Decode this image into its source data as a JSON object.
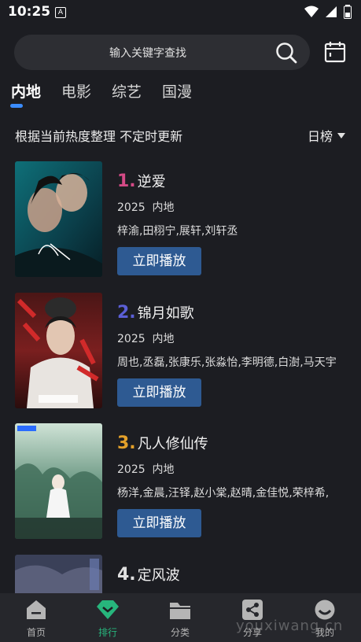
{
  "status_bar": {
    "time": "10:25",
    "badge": "A"
  },
  "search": {
    "placeholder": "输入关键字查找"
  },
  "tabs": [
    {
      "label": "内地",
      "active": true
    },
    {
      "label": "电影",
      "active": false
    },
    {
      "label": "综艺",
      "active": false
    },
    {
      "label": "国漫",
      "active": false
    }
  ],
  "subtitle": "根据当前热度整理 不定时更新",
  "rank_select": {
    "selected": "日榜"
  },
  "list": [
    {
      "rank": "1.",
      "rank_color": "#d44a86",
      "title": "逆爱",
      "year": "2025",
      "region": "内地",
      "cast": "梓渝,田栩宁,展轩,刘轩丞",
      "button": "立即播放"
    },
    {
      "rank": "2.",
      "rank_color": "#5b5fd6",
      "title": "锦月如歌",
      "year": "2025",
      "region": "内地",
      "cast": "周也,丞磊,张康乐,张淼怡,李明德,白澍,马天宇",
      "button": "立即播放"
    },
    {
      "rank": "3.",
      "rank_color": "#e3a02a",
      "title": "凡人修仙传",
      "year": "2025",
      "region": "内地",
      "cast": "杨洋,金晨,汪铎,赵小棠,赵晴,金佳悦,荣梓希,",
      "button": "立即播放"
    },
    {
      "rank": "4.",
      "rank_color": "#e0e0e0",
      "title": "定风波",
      "year": "",
      "region": "",
      "cast": "",
      "button": ""
    }
  ],
  "tabbar": [
    {
      "label": "首页",
      "icon": "home-icon",
      "active": false
    },
    {
      "label": "排行",
      "icon": "rank-icon",
      "active": true
    },
    {
      "label": "分类",
      "icon": "folder-icon",
      "active": false
    },
    {
      "label": "分享",
      "icon": "share-icon",
      "active": false
    },
    {
      "label": "我的",
      "icon": "profile-icon",
      "active": false
    }
  ],
  "watermark": "youxiwang.cn",
  "colors": {
    "accent": "#3b8cff",
    "active_tab": "#27b57c",
    "button": "#2e5a92"
  }
}
